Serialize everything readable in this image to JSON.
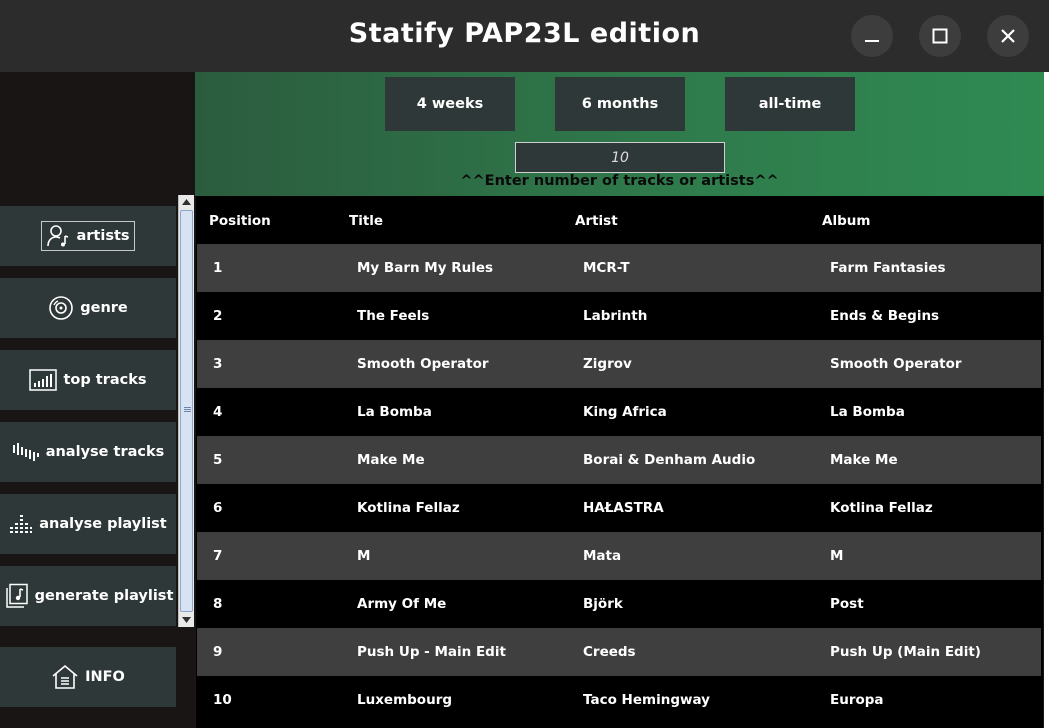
{
  "window": {
    "title": "Statify PAP23L edition"
  },
  "sidebar": {
    "items": [
      {
        "label": "artists",
        "icon": "user-music-icon",
        "selected": true
      },
      {
        "label": "genre",
        "icon": "disc-icon"
      },
      {
        "label": "top tracks",
        "icon": "bar-chart-icon"
      },
      {
        "label": "analyse tracks",
        "icon": "waveform-icon"
      },
      {
        "label": "analyse playlist",
        "icon": "equalizer-icon"
      },
      {
        "label": "generate playlist",
        "icon": "playlist-music-icon"
      }
    ],
    "info_label": "INFO"
  },
  "ranges": {
    "weeks": "4 weeks",
    "months": "6 months",
    "all": "all-time"
  },
  "count": {
    "value": "10",
    "hint": "^^Enter number of tracks or artists^^"
  },
  "table": {
    "headers": [
      "Position",
      "Title",
      "Artist",
      "Album"
    ],
    "rows": [
      [
        "1",
        "My Barn My Rules",
        "MCR-T",
        "Farm Fantasies"
      ],
      [
        "2",
        "The Feels",
        "Labrinth",
        "Ends & Begins"
      ],
      [
        "3",
        "Smooth Operator",
        "Zigrov",
        "Smooth Operator"
      ],
      [
        "4",
        "La Bomba",
        "King Africa",
        "La Bomba"
      ],
      [
        "5",
        "Make Me",
        "Borai & Denham Audio",
        "Make Me"
      ],
      [
        "6",
        "Kotlina Fellaz",
        "HAŁASTRA",
        "Kotlina Fellaz"
      ],
      [
        "7",
        "M",
        "Mata",
        "M"
      ],
      [
        "8",
        "Army Of Me",
        "Björk",
        "Post"
      ],
      [
        "9",
        "Push Up - Main Edit",
        "Creeds",
        "Push Up (Main Edit)"
      ],
      [
        "10",
        "Luxembourg",
        "Taco Hemingway",
        "Europa"
      ]
    ]
  },
  "colors": {
    "button_bg": "#2f3838",
    "green_accent": "#2f8a52",
    "row_alt": "#3f3f3f"
  }
}
